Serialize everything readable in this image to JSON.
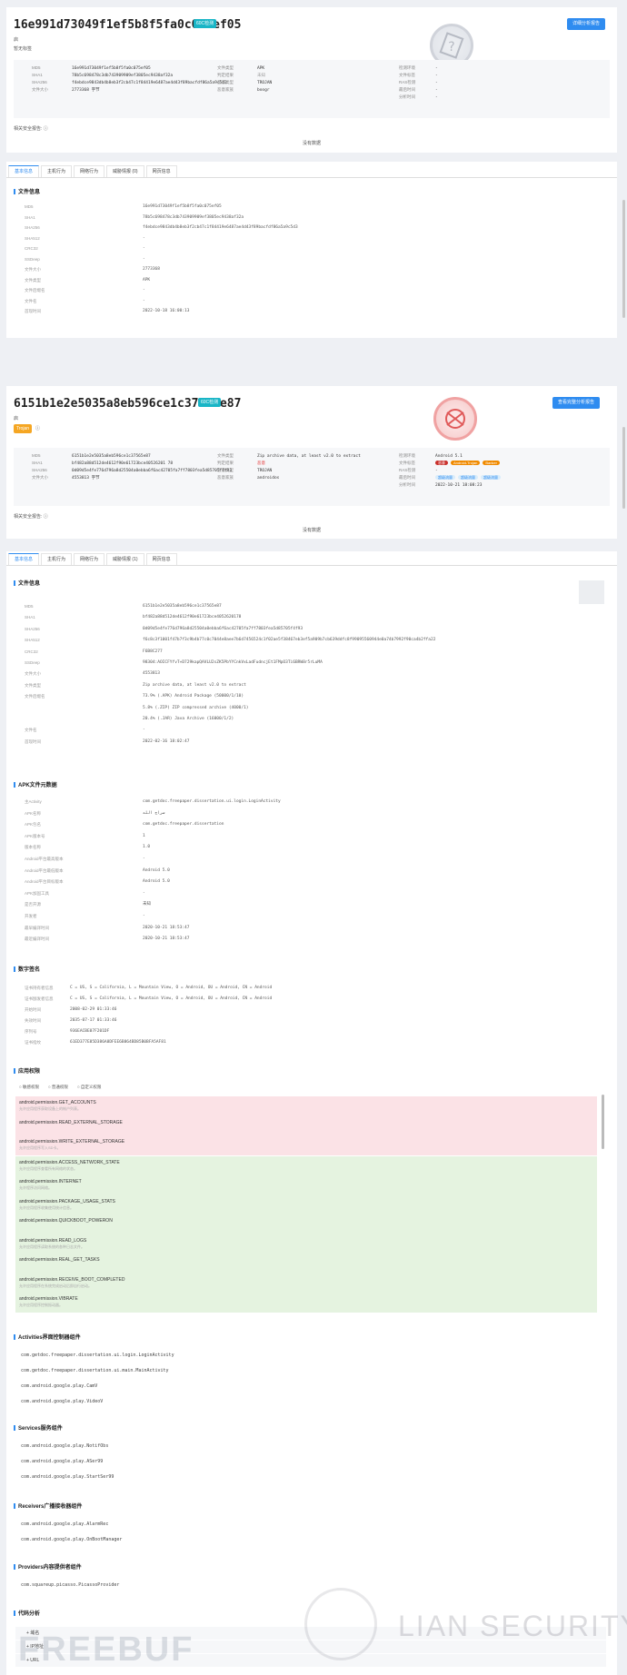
{
  "report1": {
    "title": "16e991d73049f1ef5b8f5fa0c075ef05",
    "tag": "60C检测",
    "line1": "启",
    "tag_label": "暂无标签",
    "report_btn": "详细分析报告",
    "meta_col1": [
      {
        "k": "MD5",
        "v": "16e991d73049f1ef5b8f5fa0c075ef05"
      },
      {
        "k": "SHA1",
        "v": "78b5c698478c3db743909909ef3805ec9438af32a"
      },
      {
        "k": "SHA256",
        "v": "f4ebdce9843db4b8eb3f2cb47c1f84419e6487ae4d43f89bacfdf86a5a9c5d3"
      },
      {
        "k": "文件大小",
        "v": "2773368 字节"
      }
    ],
    "meta_col2": [
      {
        "k": "文件类型",
        "v": "APK"
      },
      {
        "k": "判定结果",
        "v": "未知"
      },
      {
        "k": "恶意类型",
        "v": "TROJAN"
      },
      {
        "k": "恶意家族",
        "v": "boogr"
      }
    ],
    "meta_col3": [
      {
        "k": "检测环境",
        "v": "-"
      },
      {
        "k": "文件标签",
        "v": "-"
      },
      {
        "k": "RAS检测",
        "v": "-"
      },
      {
        "k": "最后时间",
        "v": "-"
      },
      {
        "k": "分析时间",
        "v": "-"
      }
    ],
    "related_label": "相关安全报告:",
    "no_data": "没有数据",
    "tabs": [
      "基本信息",
      "主机行为",
      "网络行为",
      "威胁情报 (0)",
      "网页信息"
    ],
    "section_file": "文件信息",
    "file_rows": [
      {
        "k": "MD5",
        "v": "16e991d73049f1ef5b8f5fa0c075ef05"
      },
      {
        "k": "SHA1",
        "v": "78b5c698478c3db743909909ef3805ec9438af32a"
      },
      {
        "k": "SHA256",
        "v": "f4ebdce9843db4b8eb3f2cb47c1f84419e6487ae4d43f89bacfdf86a5a9c5d3"
      },
      {
        "k": "SHA512",
        "v": "-"
      },
      {
        "k": "CRC32",
        "v": "-"
      },
      {
        "k": "SSDeep",
        "v": "-"
      },
      {
        "k": "文件大小",
        "v": "2773368"
      },
      {
        "k": "文件类型",
        "v": "APK"
      },
      {
        "k": "文件后缀名",
        "v": "-"
      },
      {
        "k": "文件名",
        "v": "-"
      },
      {
        "k": "首现时间",
        "v": "2022-10-18 16:00:13"
      }
    ]
  },
  "report2": {
    "title": "6151b1e2e5035a8eb596ce1c37565e87",
    "tag": "60C检测",
    "line1": "启",
    "label_badge": "Trojan",
    "report_btn": "查看完整分析报告",
    "meta_col1": [
      {
        "k": "MD5",
        "v": "6151b1e2e5035a8eb596ce1c37565e87"
      },
      {
        "k": "SHA1",
        "v": "bf482a88d512de4612f90e61723bce40526201 78"
      },
      {
        "k": "SHA256",
        "v": "0d09d5e4fe776d796a8d25504a0ebba6f6ac42705fa7ff7803fea5d85705f4f93"
      },
      {
        "k": "文件大小",
        "v": "4553813 字节"
      }
    ],
    "meta_col2": [
      {
        "k": "文件类型",
        "v": "Zip archive data, at least v2.0 to extract"
      },
      {
        "k": "判定结果",
        "v": "恶意"
      },
      {
        "k": "恶意类型",
        "v": "TROJAN"
      },
      {
        "k": "恶意家族",
        "v": "androidos"
      }
    ],
    "meta_col3": [
      {
        "k": "检测环境",
        "v": "Android 5.1"
      },
      {
        "k": "文件标签",
        "v": ""
      },
      {
        "k": "RAS检测",
        "v": "-"
      },
      {
        "k": "最后时间",
        "v": ""
      },
      {
        "k": "分析时间",
        "v": "2022-10-21 18:08:23"
      }
    ],
    "file_labels": [
      "恶意",
      "Android-Trojan",
      "Banker"
    ],
    "last_labels": [
      "超级流量",
      "超级流量",
      "超级流量"
    ],
    "related_label": "相关安全报告:",
    "no_data": "没有数据",
    "tabs": [
      "基本信息",
      "主机行为",
      "网络行为",
      "威胁情报 (1)",
      "网页信息"
    ],
    "section_file": "文件信息",
    "file_rows": [
      {
        "k": "MD5",
        "v": "6151b1e2e5035a8eb596ce1c37565e87"
      },
      {
        "k": "SHA1",
        "v": "bf482a88d512de4612f90e61723bce4052620178"
      },
      {
        "k": "SHA256",
        "v": "0d09d5e4fe776d796a8d25504a0ebba6f6ac42705fa7ff7803fea5d85705f4f93"
      },
      {
        "k": "SHA512",
        "v": "f6c8c3f1001f47b7f3c9b4b77c0c7044e8aee7b6d7456524c1f02ae5f38467eb3ef5a909b7cb639ddfc8f99095560944e0a74b7992f90ca4b2ffa22"
      },
      {
        "k": "CRC32",
        "v": "F6B8C277"
      },
      {
        "k": "SSDeep",
        "v": "98304:AOICFYfvT+D729kapQAVLU2sZK5PbYYCnkVxLadFudncjEt1FMpO3Ti6BRW8r5rLuMA"
      },
      {
        "k": "文件大小",
        "v": "4553813"
      },
      {
        "k": "文件类型",
        "v": "Zip archive data, at least v2.0 to extract"
      },
      {
        "k": "文件后缀名",
        "v": "73.9% (.APK) Android Package (50000/1/10)"
      },
      {
        "k": "",
        "v": "5.8% (.ZIP) ZIP compressed archive (4000/1)"
      },
      {
        "k": "",
        "v": "20.4% (.JAR) Java Archive (16000/1/2)"
      },
      {
        "k": "文件名",
        "v": "-"
      },
      {
        "k": "首现时间",
        "v": "2022-02-16 18:02:47"
      }
    ],
    "section_apk": "APK文件元数据",
    "apk_rows": [
      {
        "k": "主Activity",
        "v": "com.getdoc.freepaper.dissertation.ui.login.LoginActivity"
      },
      {
        "k": "APK名称",
        "v": "سراج الله"
      },
      {
        "k": "APK包名",
        "v": "com.getdoc.freepaper.dissertation"
      },
      {
        "k": "APK版本号",
        "v": "1"
      },
      {
        "k": "版本名称",
        "v": "1.0"
      },
      {
        "k": "Android平台最高版本",
        "v": "-"
      },
      {
        "k": "Android平台最低版本",
        "v": "Android 5.0"
      },
      {
        "k": "Android平台目标版本",
        "v": "Android 5.0"
      },
      {
        "k": "APK加固工具",
        "v": "-"
      },
      {
        "k": "是否开源",
        "v": "未知"
      },
      {
        "k": "开发者",
        "v": "-"
      },
      {
        "k": "最早编译时间",
        "v": "2020-10-21 18:53:47"
      },
      {
        "k": "最近编译时间",
        "v": "2020-10-21 18:53:47"
      }
    ],
    "section_cert": "数字签名",
    "cert_rows": [
      {
        "k": "证书持有者信息",
        "v": "C = US, S = California, L = Mountain View, O = Android, OU = Android, CN = Android"
      },
      {
        "k": "证书颁发者信息",
        "v": "C = US, S = California, L = Mountain View, O = Android, OU = Android, CN = Android"
      },
      {
        "k": "开始时间",
        "v": "2008-02-29 01:33:46"
      },
      {
        "k": "失效时间",
        "v": "2035-07-17 01:33:46"
      },
      {
        "k": "序列号",
        "v": "936EACBE07F201DF"
      },
      {
        "k": "证书指纹",
        "v": "61ED377E85D386A8DFEE6B864BD85B0BFA5AF81"
      }
    ],
    "section_perm": "应用权限",
    "perm_filters": [
      "敏感权限",
      "普通权限",
      "自定义权限"
    ],
    "perms_danger": [
      {
        "n": "android.permission.GET_ACCOUNTS",
        "d": "允许应用程序获取设备上的帐户列表。"
      },
      {
        "n": "android.permission.READ_EXTERNAL_STORAGE",
        "d": ""
      },
      {
        "n": "android.permission.WRITE_EXTERNAL_STORAGE",
        "d": "允许应用程序写入SD卡。"
      }
    ],
    "perms_normal": [
      {
        "n": "android.permission.ACCESS_NETWORK_STATE",
        "d": "允许应用程序查看所有网络的状态。"
      },
      {
        "n": "android.permission.INTERNET",
        "d": "允许程序访问网络。"
      },
      {
        "n": "android.permission.PACKAGE_USAGE_STATS",
        "d": "允许应用程序收集使用统计信息。"
      },
      {
        "n": "android.permission.QUICKBOOT_POWERON",
        "d": ""
      },
      {
        "n": "android.permission.READ_LOGS",
        "d": "允许应用程序读取系统的各种日志文件。"
      },
      {
        "n": "android.permission.REAL_GET_TASKS",
        "d": ""
      },
      {
        "n": "android.permission.RECEIVE_BOOT_COMPLETED",
        "d": "允许应用程序在系统完成启动后即自行启动。"
      },
      {
        "n": "android.permission.VIBRATE",
        "d": "允许应用程序控制振动器。"
      }
    ],
    "section_act": "Activities界面控制器组件",
    "activities": [
      "com.getdoc.freepaper.dissertation.ui.login.LoginActivity",
      "com.getdoc.freepaper.dissertation.ui.main.MainActivity",
      "com.android.google.play.CamV",
      "com.android.google.play.VideoV"
    ],
    "section_svc": "Services服务组件",
    "services": [
      "com.android.google.play.NotifObs",
      "com.android.google.play.ASer99",
      "com.android.google.play.StartSer99"
    ],
    "section_rcv": "Receivers广播接收器组件",
    "receivers": [
      "com.android.google.play.AlarmRec",
      "com.android.google.play.OnBootManager"
    ],
    "section_prv": "Providers内容提供者组件",
    "providers": [
      "com.squareup.picasso.PicassoProvider"
    ],
    "section_code": "代码分析",
    "code_items": [
      "+ 域名",
      "+ IP地址",
      "+ URL"
    ]
  },
  "watermark": {
    "left": "FREEBUF",
    "right": "LIAN SECURITY"
  },
  "colors": {
    "accent": "#2f8cf0",
    "danger_bg": "#fbe2e6",
    "normal_bg": "#e5f3e0"
  }
}
